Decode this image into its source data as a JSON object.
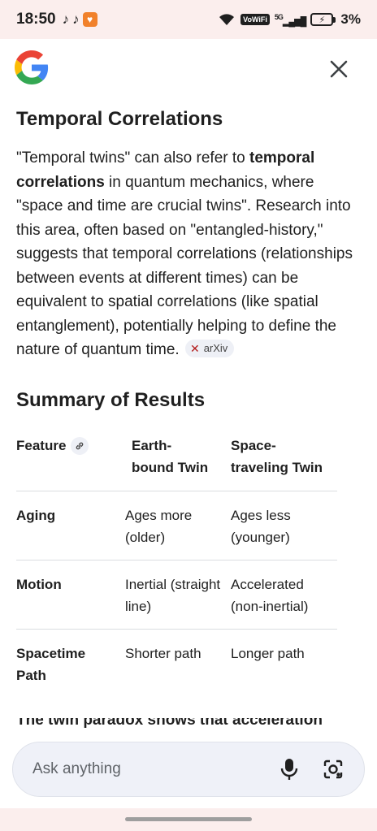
{
  "status_bar": {
    "time": "18:50",
    "volte": "VoWiFi",
    "network": "5G",
    "battery": "3%"
  },
  "heading_correlations": "Temporal Correlations",
  "paragraph": {
    "part1": "\"Temporal twins\" can also refer to ",
    "bold1": "temporal correlations",
    "part2": " in quantum mechanics, where \"space and time are crucial twins\". Research into this area, often based on \"entangled-history,\" suggests that temporal correlations (relationships between events at different times) can be equivalent to spatial correlations (like spatial entanglement), potentially helping to define the nature of quantum time. ",
    "source_chip": "arXiv"
  },
  "heading_summary": "Summary of Results",
  "table": {
    "headers": [
      "Feature",
      "Earth-\nbound Twin",
      "Space-\ntraveling Twin"
    ],
    "rows": [
      {
        "feature": "Aging",
        "earth": "Ages more (older)",
        "space": "Ages less (younger)"
      },
      {
        "feature": "Motion",
        "earth": "Inertial (straight line)",
        "space": "Accelerated (non-inertial)"
      },
      {
        "feature": "Spacetime Path",
        "earth": "Shorter path",
        "space": "Longer path"
      }
    ]
  },
  "trailing_text": "The twin paradox shows that acceleration ch",
  "ask_bar": {
    "placeholder": "Ask anything"
  },
  "icons": {
    "logo": "google-logo",
    "close": "close-icon",
    "mic": "mic-icon",
    "lens": "camera-lens-icon",
    "link": "link-icon"
  }
}
